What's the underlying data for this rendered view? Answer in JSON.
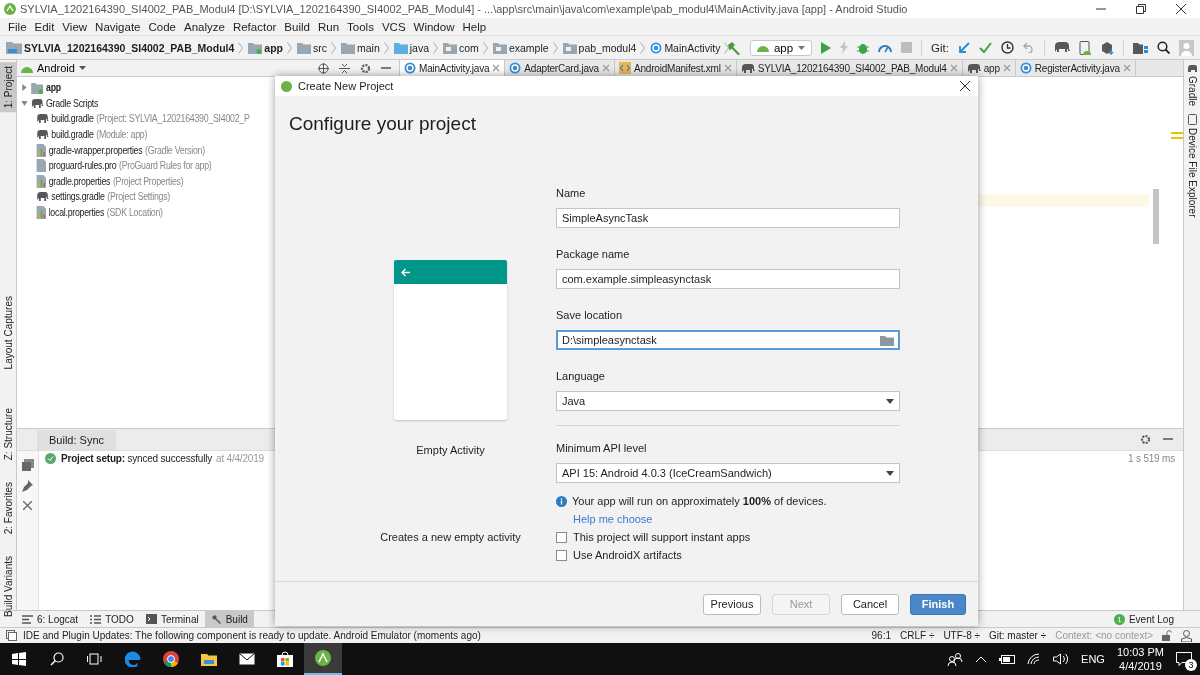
{
  "window": {
    "title": "SYLVIA_1202164390_SI4002_PAB_Modul4 [D:\\SYLVIA_1202164390_SI4002_PAB_Modul4] - ...\\app\\src\\main\\java\\com\\example\\pab_modul4\\MainActivity.java [app] - Android Studio"
  },
  "menu": [
    "File",
    "Edit",
    "View",
    "Navigate",
    "Code",
    "Analyze",
    "Refactor",
    "Build",
    "Run",
    "Tools",
    "VCS",
    "Window",
    "Help"
  ],
  "breadcrumbs": [
    {
      "label": "SYLVIA_1202164390_SI4002_PAB_Modul4",
      "kind": "project"
    },
    {
      "label": "app",
      "kind": "module"
    },
    {
      "label": "src",
      "kind": "folder"
    },
    {
      "label": "main",
      "kind": "folder"
    },
    {
      "label": "java",
      "kind": "source"
    },
    {
      "label": "com",
      "kind": "package"
    },
    {
      "label": "example",
      "kind": "package"
    },
    {
      "label": "pab_modul4",
      "kind": "package"
    },
    {
      "label": "MainActivity",
      "kind": "class"
    }
  ],
  "toolbar": {
    "run_config": "app",
    "git_label": "Git:"
  },
  "left_strip": [
    {
      "label": "1: Project",
      "selected": true
    },
    {
      "label": "Layout Captures",
      "selected": false
    },
    {
      "label": "Z: Structure",
      "selected": false
    },
    {
      "label": "2: Favorites",
      "selected": false
    },
    {
      "label": "Build Variants",
      "selected": false
    }
  ],
  "right_strip": [
    {
      "label": "Gradle",
      "kind": "gradle"
    },
    {
      "label": "Device File Explorer",
      "kind": "device"
    }
  ],
  "project_panel": {
    "view": "Android",
    "tree": [
      {
        "label": "app",
        "kind": "module",
        "expanded": false
      },
      {
        "label": "Gradle Scripts",
        "kind": "gradle",
        "expanded": true,
        "children": [
          {
            "label": "build.gradle",
            "note": "(Project: SYLVIA_1202164390_SI4002_P",
            "kind": "gradle"
          },
          {
            "label": "build.gradle",
            "note": "(Module: app)",
            "kind": "gradle"
          },
          {
            "label": "gradle-wrapper.properties",
            "note": "(Gradle Version)",
            "kind": "properties"
          },
          {
            "label": "proguard-rules.pro",
            "note": "(ProGuard Rules for app)",
            "kind": "file"
          },
          {
            "label": "gradle.properties",
            "note": "(Project Properties)",
            "kind": "properties"
          },
          {
            "label": "settings.gradle",
            "note": "(Project Settings)",
            "kind": "gradle"
          },
          {
            "label": "local.properties",
            "note": "(SDK Location)",
            "kind": "properties"
          }
        ]
      }
    ]
  },
  "editor_tabs": [
    {
      "label": "MainActivity.java",
      "kind": "class",
      "selected": true
    },
    {
      "label": "AdapterCard.java",
      "kind": "class",
      "selected": false
    },
    {
      "label": "AndroidManifest.xml",
      "kind": "xml",
      "selected": false
    },
    {
      "label": "SYLVIA_1202164390_SI4002_PAB_Modul4",
      "kind": "gradle",
      "selected": false
    },
    {
      "label": "app",
      "kind": "gradle",
      "selected": false
    },
    {
      "label": "RegisterActivity.java",
      "kind": "class",
      "selected": false
    }
  ],
  "build_panel": {
    "tab": "Build: Sync",
    "message": "**Project setup:** synced successfully",
    "time": "at 4/4/2019",
    "duration": "1 s 519 ms"
  },
  "bottom_tabs": [
    {
      "label": "6: Logcat",
      "kind": "logcat",
      "selected": false
    },
    {
      "label": "TODO",
      "kind": "todo",
      "selected": false
    },
    {
      "label": "Terminal",
      "kind": "terminal",
      "selected": false
    },
    {
      "label": "Build",
      "kind": "build",
      "selected": true
    }
  ],
  "event_log": {
    "label": "Event Log",
    "count": "1"
  },
  "status_bar": {
    "message": "IDE and Plugin Updates: The following component is ready to update. Android Emulator (moments ago)",
    "position": "96:1",
    "line_ending": "CRLF ÷",
    "encoding": "UTF-8 ÷",
    "git": "Git: master ÷",
    "context": "Context: <no context>"
  },
  "dialog": {
    "title": "Create New Project",
    "heading": "Configure your project",
    "template": {
      "name": "Empty Activity",
      "description": "Creates a new empty activity"
    },
    "fields": [
      {
        "label": "Name",
        "value": "SimpleAsyncTask",
        "kind": "text",
        "focused": false
      },
      {
        "label": "Package name",
        "value": "com.example.simpleasynctask",
        "kind": "text",
        "focused": false
      },
      {
        "label": "Save location",
        "value": "D:\\simpleasynctask",
        "kind": "folder",
        "focused": true
      },
      {
        "label": "Language",
        "value": "Java",
        "kind": "select",
        "focused": false
      },
      {
        "label": "Minimum API level",
        "value": "API 15: Android 4.0.3 (IceCreamSandwich)",
        "kind": "select",
        "focused": false
      }
    ],
    "info": "Your app will run on approximately **100%** of devices.",
    "help_link": "Help me choose",
    "checkboxes": [
      {
        "label": "This project will support instant apps",
        "checked": false
      },
      {
        "label": "Use AndroidX artifacts",
        "checked": false
      }
    ],
    "buttons": [
      {
        "label": "Previous",
        "kind": "default",
        "disabled": false
      },
      {
        "label": "Next",
        "kind": "default",
        "disabled": true
      },
      {
        "label": "Cancel",
        "kind": "default",
        "disabled": false
      },
      {
        "label": "Finish",
        "kind": "primary",
        "disabled": false
      }
    ]
  },
  "taskbar": {
    "language": "ENG",
    "time": "10:03 PM",
    "date": "4/4/2019",
    "notifications": "3"
  }
}
